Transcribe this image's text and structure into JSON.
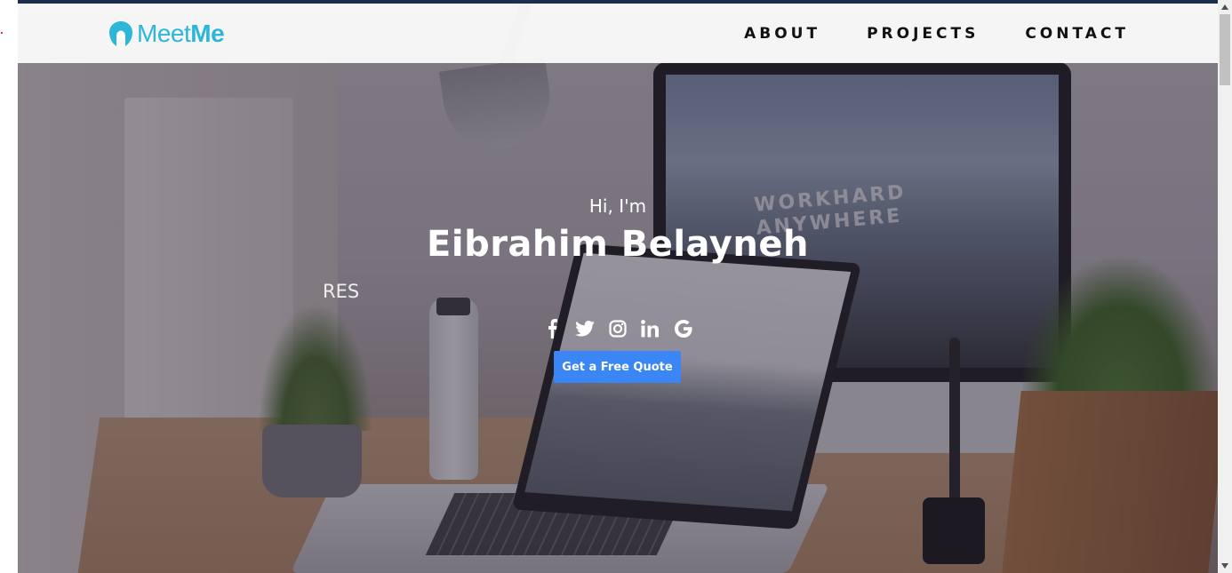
{
  "navbar": {
    "logo": {
      "text_light": "Meet",
      "text_bold": "Me",
      "icon": "person-head-icon",
      "color": "#2cb6d8"
    },
    "links": [
      {
        "label": "ABOUT"
      },
      {
        "label": "PROJECTS"
      },
      {
        "label": "CONTACT"
      }
    ]
  },
  "hero": {
    "greeting": "Hi, I'm",
    "name": "Eibrahim Belayneh",
    "typed_text": "RES",
    "social": [
      {
        "icon": "facebook-icon"
      },
      {
        "icon": "twitter-icon"
      },
      {
        "icon": "instagram-icon"
      },
      {
        "icon": "linkedin-icon"
      },
      {
        "icon": "google-icon"
      }
    ],
    "cta_label": "Get a Free Quote",
    "cta_color": "#3a86f5",
    "background_text": "WORKHARD ANYWHERE"
  }
}
